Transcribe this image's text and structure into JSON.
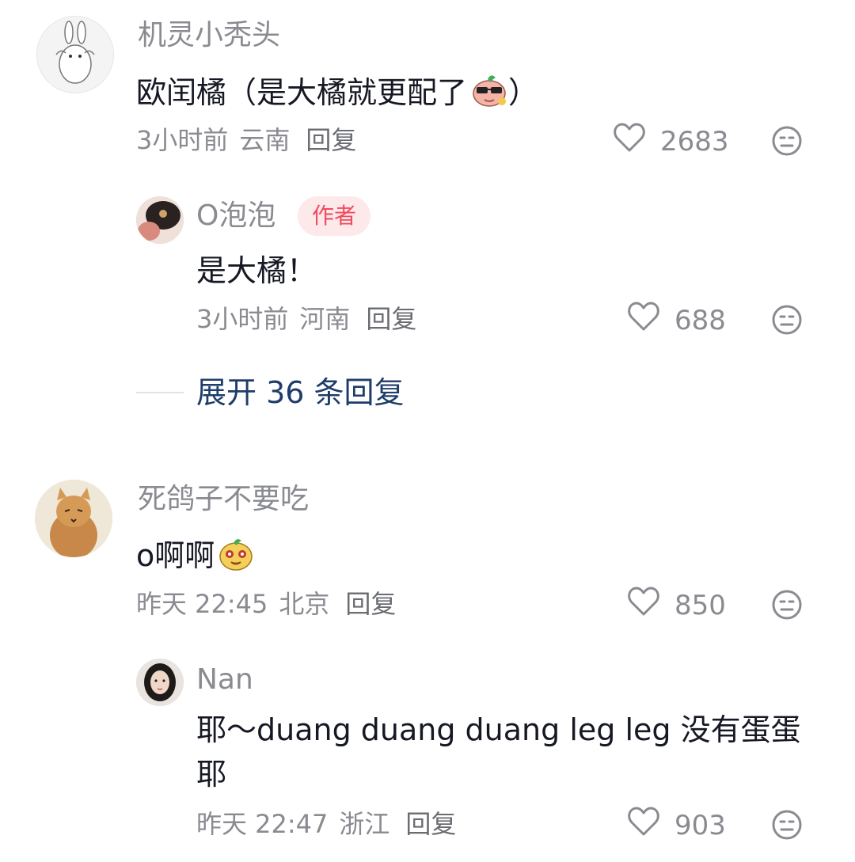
{
  "comments": [
    {
      "username": "机灵小秃头",
      "text": "欧闰橘（是大橘就更配了",
      "text_tail": "）",
      "time": "3小时前",
      "location": "云南",
      "reply": "回复",
      "likes": "2683",
      "emoji": "pink-cool-sunglasses-emoji",
      "avatar": "white-rabbit-doodle-avatar",
      "replies": [
        {
          "username": "O泡泡",
          "badge": "作者",
          "text": "是大橘！",
          "time": "3小时前",
          "location": "河南",
          "reply": "回复",
          "likes": "688",
          "avatar": "photo-avatar-hair"
        }
      ],
      "expand": "展开 36 条回复"
    },
    {
      "username": "死鸽子不要吃",
      "text": "o啊啊",
      "time": "昨天 22:45",
      "location": "北京",
      "reply": "回复",
      "likes": "850",
      "emoji": "yellow-smile-emoji",
      "avatar": "orange-cat-avatar",
      "replies": [
        {
          "username": "Nan",
          "text_line1": "耶～duang duang duang leg leg 没有蛋蛋",
          "text_line2": "耶",
          "time": "昨天 22:47",
          "location": "浙江",
          "reply": "回复",
          "likes": "903",
          "avatar": "girl-portrait-avatar"
        }
      ]
    }
  ],
  "colors": {
    "accent_link": "#1f3d6a",
    "badge_bg": "#fde8ea",
    "badge_text": "#f04a5d",
    "meta_gray": "#8a8b91"
  }
}
